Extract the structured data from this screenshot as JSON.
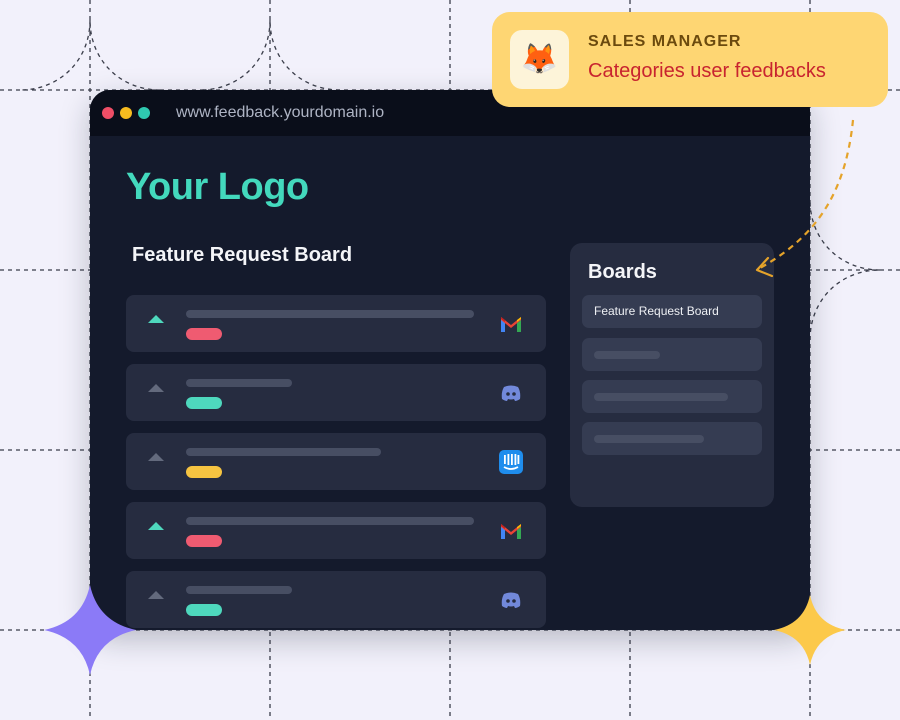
{
  "window": {
    "url": "www.feedback.yourdomain.io",
    "traffic_lights": [
      "#ef4e66",
      "#f6bb1f",
      "#2fc9b0"
    ]
  },
  "logo": "Your Logo",
  "feature_board": {
    "title": "Feature Request Board",
    "cards": [
      {
        "upvoted": true,
        "tag_color": "#ef5b71",
        "source_icon": "gmail-icon"
      },
      {
        "upvoted": false,
        "tag_color": "#4ed8bd",
        "source_icon": "discord-icon"
      },
      {
        "upvoted": false,
        "tag_color": "#f6c441",
        "source_icon": "intercom-icon"
      },
      {
        "upvoted": true,
        "tag_color": "#ef5b71",
        "source_icon": "gmail-icon"
      },
      {
        "upvoted": false,
        "tag_color": "#4ed8bd",
        "source_icon": "discord-icon"
      }
    ]
  },
  "boards": {
    "title": "Boards",
    "items": [
      {
        "label": "Feature Request Board"
      },
      {
        "label": ""
      },
      {
        "label": ""
      },
      {
        "label": ""
      }
    ]
  },
  "note": {
    "avatar": "fox-emoji",
    "role": "SALES MANAGER",
    "text": "Categories user feedbacks"
  },
  "colors": {
    "accent": "#43d9bd",
    "note_bg": "#fed673",
    "note_text": "#c8242f",
    "purple_sparkle": "#8b7af7",
    "yellow_sparkle": "#fcc94a"
  }
}
